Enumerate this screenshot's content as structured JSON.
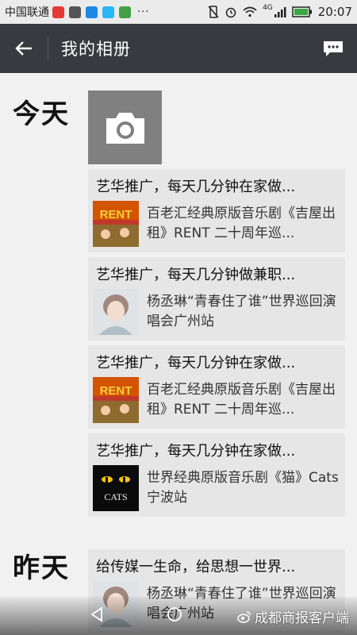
{
  "status_bar": {
    "carrier": "中国联通",
    "more": "···",
    "network": "4G",
    "time": "20:07"
  },
  "header": {
    "title": "我的相册"
  },
  "sections": [
    {
      "label": "今天",
      "cards": [
        {
          "title": "艺华推广，每天几分钟在家做...",
          "subtitle": "百老汇经典原版音乐剧《吉屋出租》RENT 二十周年巡...",
          "thumb": "rent-poster"
        },
        {
          "title": "艺华推广，每天几分钟做兼职...",
          "subtitle": "杨丞琳“青春住了谁”世界巡回演唱会广州站",
          "thumb": "portrait"
        },
        {
          "title": "艺华推广，每天几分钟在家做...",
          "subtitle": "百老汇经典原版音乐剧《吉屋出租》RENT 二十周年巡...",
          "thumb": "rent-poster"
        },
        {
          "title": "艺华推广，每天几分钟在家做...",
          "subtitle": "世界经典原版音乐剧《猫》Cats 宁波站",
          "thumb": "cats-poster"
        }
      ]
    },
    {
      "label": "昨天",
      "cards": [
        {
          "title": "给传媒一生命，给思想一世界...",
          "subtitle": "杨丞琳“青春住了谁”世界巡回演唱会广州站",
          "thumb": "portrait"
        }
      ]
    }
  ],
  "watermark": "成都商报客户端",
  "thumb_text": {
    "rent": "RENT",
    "cats": "CATS"
  },
  "colors": {
    "titlebar": "#393a3f",
    "background": "#f1f1f1",
    "card": "#e6e6e6"
  }
}
